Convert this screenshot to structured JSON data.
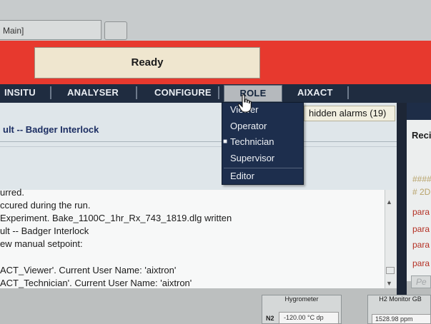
{
  "window": {
    "tab_title": "Main]"
  },
  "status": {
    "text": "Ready"
  },
  "menubar": {
    "items": [
      "INSITU",
      "ANALYSER",
      "CONFIGURE",
      "ROLE",
      "AIXACT"
    ]
  },
  "role_menu": {
    "items": [
      "Viewer",
      "Operator",
      "Technician",
      "Supervisor",
      "Editor"
    ],
    "selected": "Technician"
  },
  "alarms": {
    "hidden_label": "hidden alarms (19)",
    "title": "ult -- Badger Interlock"
  },
  "log": {
    "lines": [
      "urred.",
      "ccured during the run.",
      "Experiment. Bake_1100C_1hr_Rx_743_1819.dlg written",
      "ult -- Badger Interlock",
      "ew manual setpoint:",
      "",
      "ACT_Viewer'. Current User Name: 'aixtron'",
      "ACT_Technician'. Current User Name: 'aixtron'"
    ]
  },
  "right_panel": {
    "title": "Reci",
    "hash_lines": [
      "####",
      "# 2D"
    ],
    "para_lines": [
      "para",
      "para",
      "para",
      "para"
    ],
    "button": "Pe"
  },
  "hygrometer": {
    "title": "Hygrometer",
    "channel": "N2",
    "value": "-120.00 °C dp"
  },
  "h2_monitor": {
    "title": "H2 Monitor GB",
    "value": "1528.98 ppm"
  },
  "colors": {
    "status_red": "#e7392e",
    "menubar": "#1f2c40",
    "dropdown": "#1d2e4d"
  },
  "icons": [
    "hand-pointer-icon",
    "scroll-up-icon",
    "scroll-down-icon"
  ]
}
